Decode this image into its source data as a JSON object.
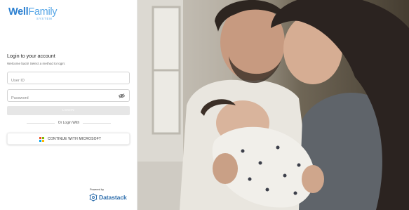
{
  "brand": {
    "logo_word1": "Well",
    "logo_word2": "Family",
    "logo_sub": "SYSTEM"
  },
  "login": {
    "title": "Login to your account",
    "subtitle": "Welcome back! Select a method to login:",
    "userid_placeholder": "User ID",
    "password_placeholder": "Password",
    "login_button": "LOGIN",
    "divider": "Or Login With",
    "microsoft_button": "CONTINUE WITH MICROSOFT"
  },
  "footer": {
    "powered_by": "Powered by",
    "company": "Datastack"
  },
  "colors": {
    "brand_blue": "#2a7fd0",
    "brand_light_blue": "#56a6e6",
    "login_button_disabled": "#e6e6e6",
    "datastack_blue": "#2f6fad",
    "ms_red": "#f25022",
    "ms_green": "#7fba00",
    "ms_blue": "#00a4ef",
    "ms_yellow": "#ffb900"
  },
  "icons": {
    "password_toggle": "eye-icon",
    "microsoft": "microsoft-logo-icon",
    "datastack": "datastack-logo-icon"
  },
  "photo": {
    "subject": "couple holding a swaddled newborn baby by a window"
  }
}
